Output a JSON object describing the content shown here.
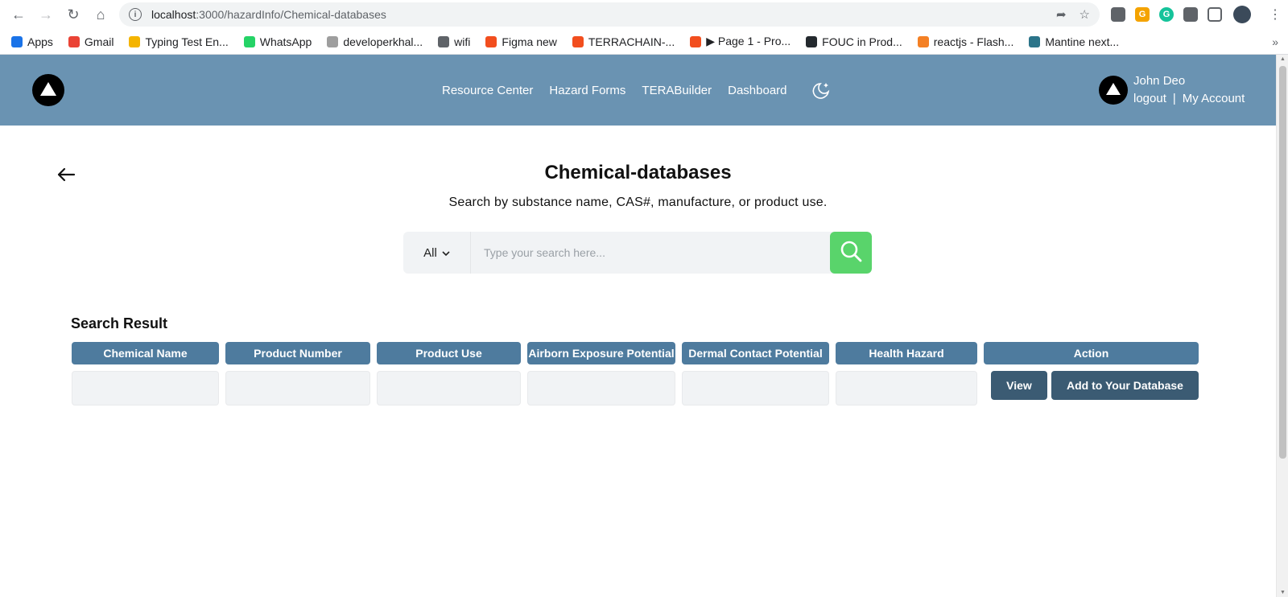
{
  "browser": {
    "url_host": "localhost",
    "url_path": ":3000/hazardInfo/Chemical-databases",
    "bookmarks": [
      {
        "label": "Apps",
        "color": "#1a73e8"
      },
      {
        "label": "Gmail",
        "color": "#ea4335"
      },
      {
        "label": "Typing Test En...",
        "color": "#f4b400"
      },
      {
        "label": "WhatsApp",
        "color": "#25d366"
      },
      {
        "label": "developerkhal...",
        "color": "#9e9e9e"
      },
      {
        "label": "wifi",
        "color": "#5f6368"
      },
      {
        "label": "Figma new",
        "color": "#f24e1e"
      },
      {
        "label": "TERRACHAIN-...",
        "color": "#f24e1e"
      },
      {
        "label": "▶ Page 1 - Pro...",
        "color": "#f24e1e"
      },
      {
        "label": "FOUC in Prod...",
        "color": "#24292e"
      },
      {
        "label": "reactjs - Flash...",
        "color": "#f48024"
      },
      {
        "label": "Mantine next...",
        "color": "#2b7489"
      }
    ],
    "more": "»"
  },
  "header": {
    "nav": [
      "Resource Center",
      "Hazard Forms",
      "TERABuilder",
      "Dashboard"
    ],
    "user_name": "John Deo",
    "logout": "logout",
    "separator": "|",
    "my_account": "My Account",
    "bg_color": "#6a93b2"
  },
  "page": {
    "title": "Chemical-databases",
    "subtitle": "Search by substance name, CAS#, manufacture, or product use.",
    "back_icon": "arrow-left-icon"
  },
  "search": {
    "scope": "All",
    "placeholder": "Type your search here...",
    "value": "",
    "button_color": "#59d46b"
  },
  "results": {
    "title": "Search Result",
    "columns": [
      "Chemical Name",
      "Product Number",
      "Product Use",
      "Airborn Exposure Potential",
      "Dermal Contact Potential",
      "Health Hazard",
      "Action"
    ],
    "rows": [
      {
        "cells": [
          "",
          "",
          "",
          "",
          "",
          ""
        ],
        "actions": [
          "View",
          "Add to Your Database"
        ]
      }
    ],
    "header_color": "#4e7b9e",
    "action_color": "#3b5b73"
  }
}
